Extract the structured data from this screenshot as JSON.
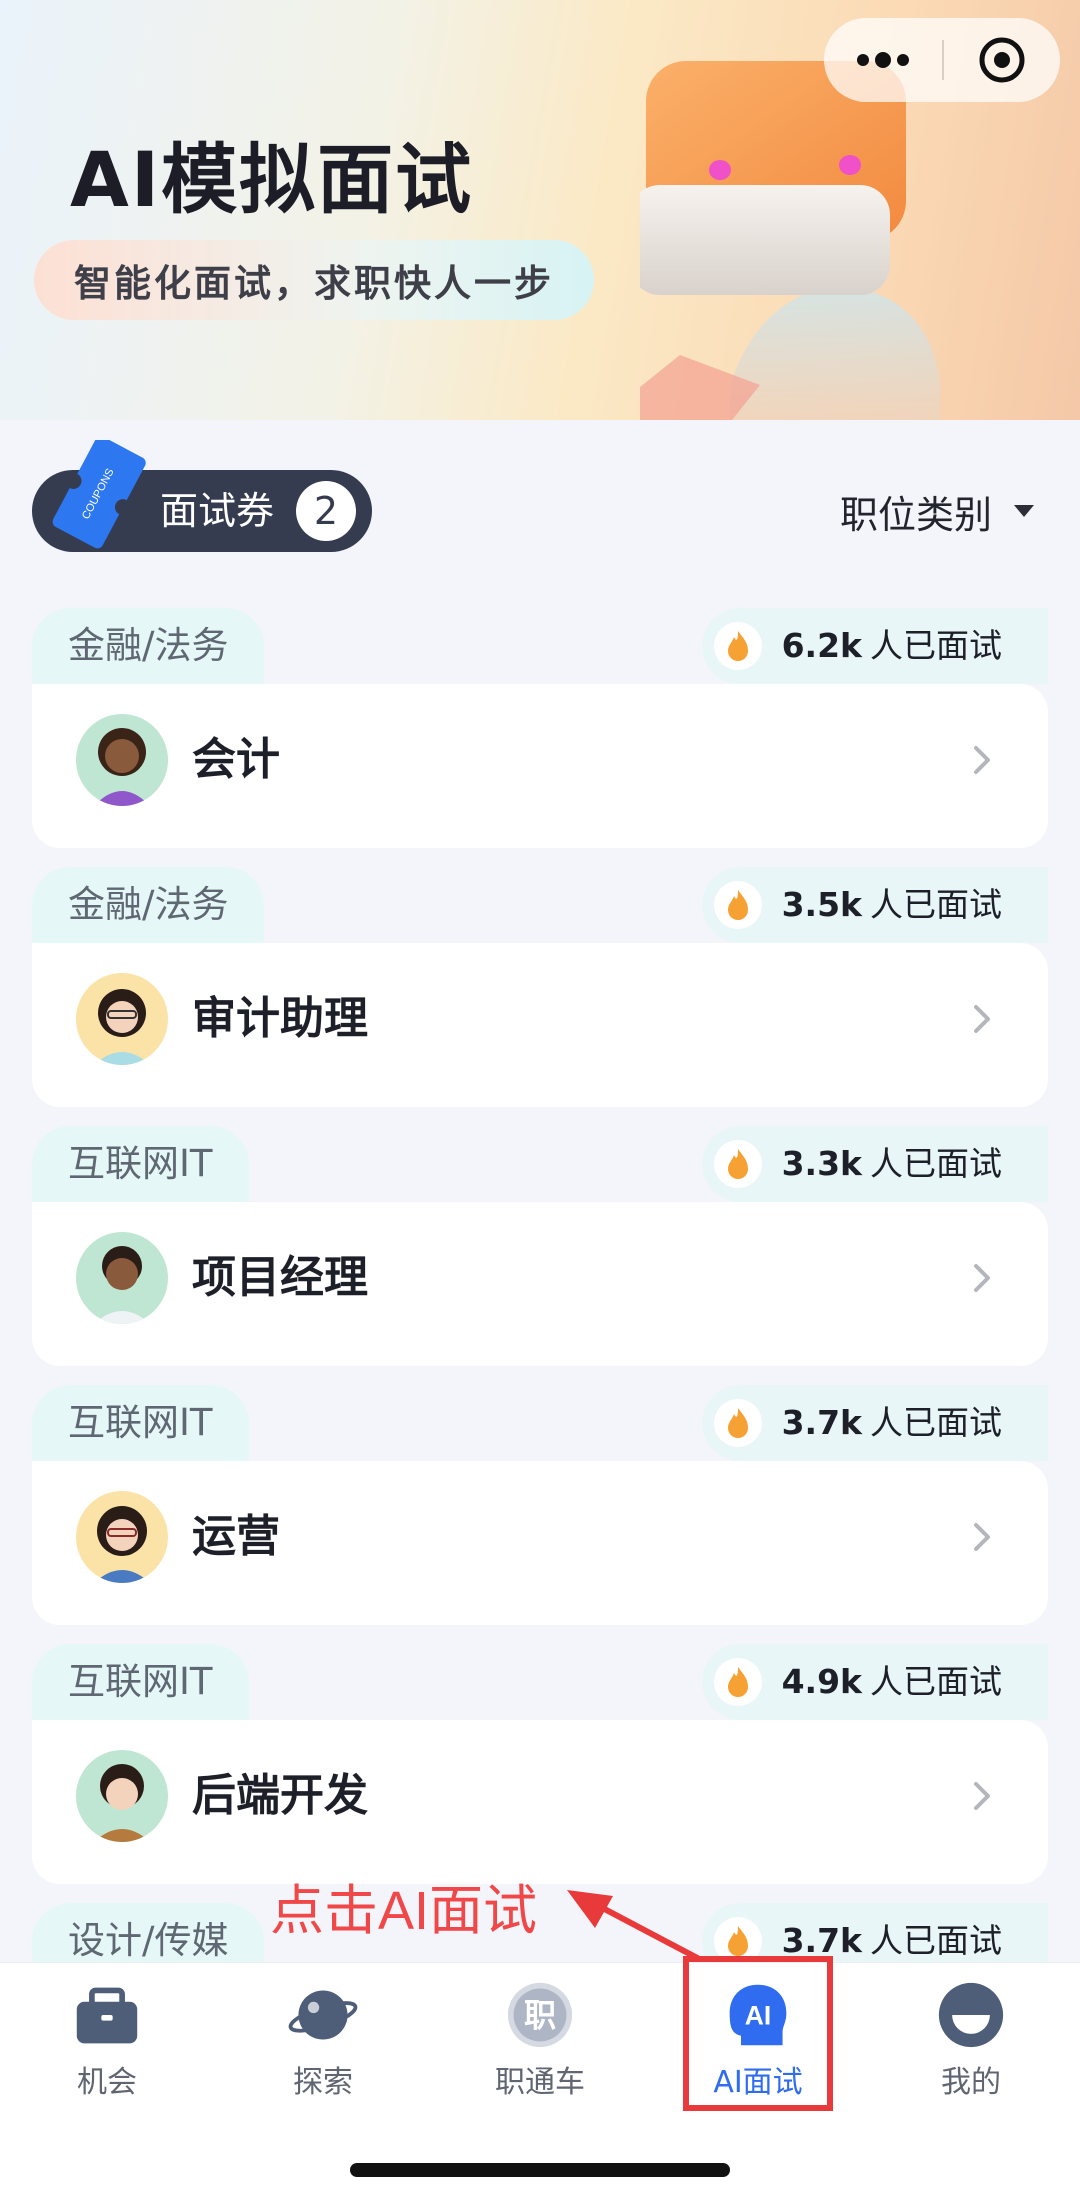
{
  "header": {
    "title": "AI模拟面试",
    "subtitle": "智能化面试，求职快人一步"
  },
  "capsule": {
    "more_icon": "more-dots-icon",
    "close_icon": "target-close-icon"
  },
  "filter": {
    "coupon_label": "面试券",
    "coupon_count": "2",
    "ticket_text": "COUPONS",
    "category_label": "职位类别"
  },
  "jobs": [
    {
      "category": "金融/法务",
      "count": "6.2k",
      "suffix": "人已面试",
      "title": "会计"
    },
    {
      "category": "金融/法务",
      "count": "3.5k",
      "suffix": "人已面试",
      "title": "审计助理"
    },
    {
      "category": "互联网IT",
      "count": "3.3k",
      "suffix": "人已面试",
      "title": "项目经理"
    },
    {
      "category": "互联网IT",
      "count": "3.7k",
      "suffix": "人已面试",
      "title": "运营"
    },
    {
      "category": "互联网IT",
      "count": "4.9k",
      "suffix": "人已面试",
      "title": "后端开发"
    },
    {
      "category": "设计/传媒",
      "count": "3.7k",
      "suffix": "人已面试",
      "title": ""
    }
  ],
  "annotation": "点击AI面试",
  "tabbar": {
    "items": [
      {
        "label": "机会",
        "icon": "briefcase-icon"
      },
      {
        "label": "探索",
        "icon": "planet-icon"
      },
      {
        "label": "职通车",
        "icon": "zhi-badge-icon",
        "glyph": "职"
      },
      {
        "label": "AI面试",
        "icon": "ai-head-icon",
        "glyph": "AI"
      },
      {
        "label": "我的",
        "icon": "profile-icon"
      }
    ],
    "active_index": 3
  },
  "colors": {
    "accent": "#2f6cf0",
    "annotation": "#e83a3a",
    "coupon_bg": "#353c50"
  }
}
